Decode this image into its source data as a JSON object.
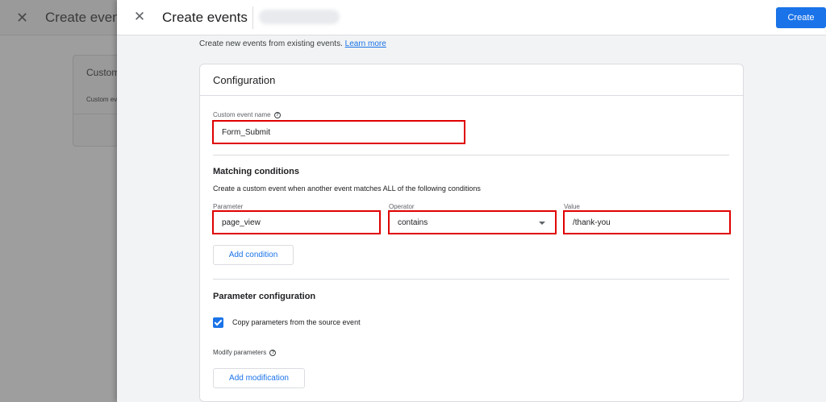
{
  "background": {
    "title": "Create events",
    "card_title": "Custom",
    "card_sub": "Custom ev"
  },
  "topbar": {
    "title": "Create events",
    "create_label": "Create"
  },
  "description": {
    "text": "Create new events from existing events.",
    "link": "Learn more"
  },
  "configuration": {
    "title": "Configuration",
    "custom_event_name": {
      "label": "Custom event name",
      "value": "Form_Submit"
    },
    "matching": {
      "title": "Matching conditions",
      "description": "Create a custom event when another event matches ALL of the following conditions",
      "parameter": {
        "label": "Parameter",
        "value": "page_view"
      },
      "operator": {
        "label": "Operator",
        "value": "contains"
      },
      "value": {
        "label": "Value",
        "value": "/thank-you"
      },
      "add_condition_label": "Add condition"
    },
    "parameter_configuration": {
      "title": "Parameter configuration",
      "copy_label": "Copy parameters from the source event",
      "copy_checked": true,
      "modify_label": "Modify parameters",
      "add_modification_label": "Add modification"
    }
  },
  "icons": {
    "close": "close-icon",
    "help": "help-icon",
    "dropdown": "chevron-down-icon",
    "checkbox": "checkbox-checked-icon"
  },
  "colors": {
    "accent": "#1a73e8",
    "highlight": "#e00000"
  }
}
